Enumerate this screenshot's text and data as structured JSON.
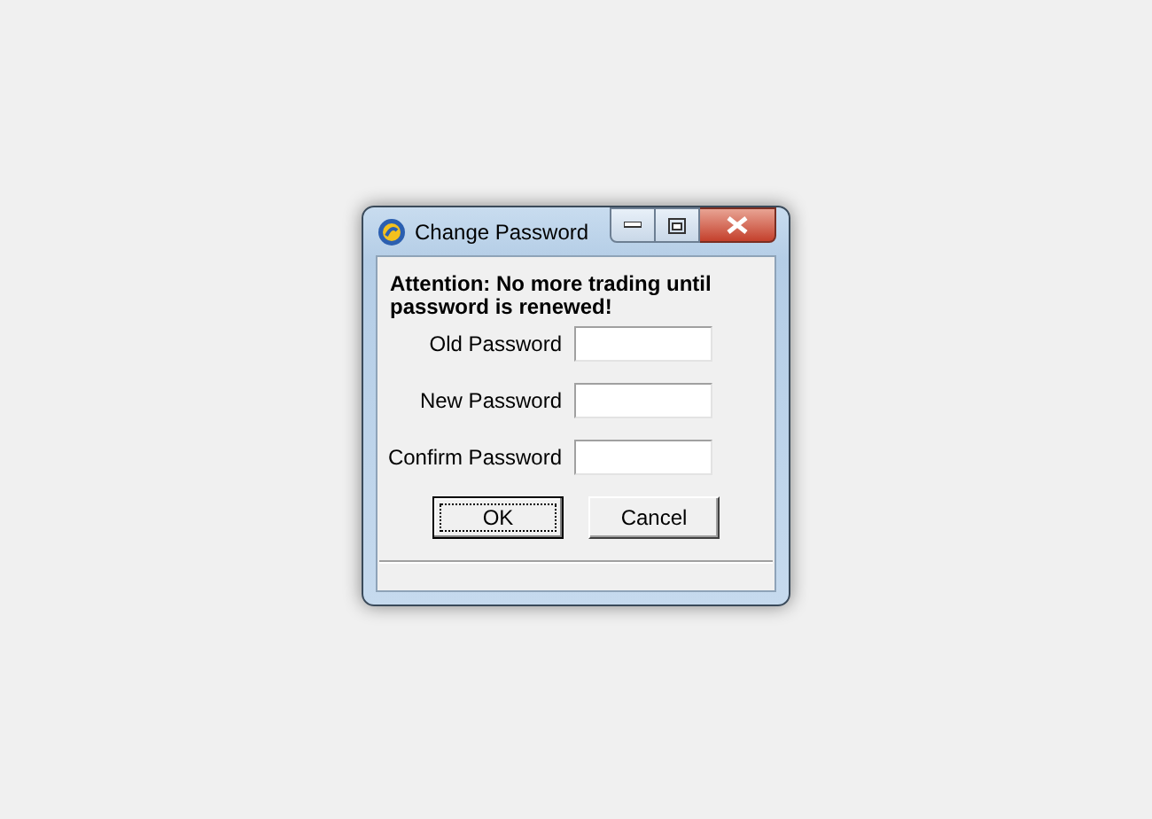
{
  "window": {
    "title": "Change Password"
  },
  "message": "Attention: No more trading until password is renewed!",
  "fields": [
    {
      "label": "Old Password"
    },
    {
      "label": "New Password"
    },
    {
      "label": "Confirm Password"
    }
  ],
  "buttons": [
    {
      "label": "OK",
      "focused": true
    },
    {
      "label": "Cancel",
      "focused": false
    }
  ]
}
